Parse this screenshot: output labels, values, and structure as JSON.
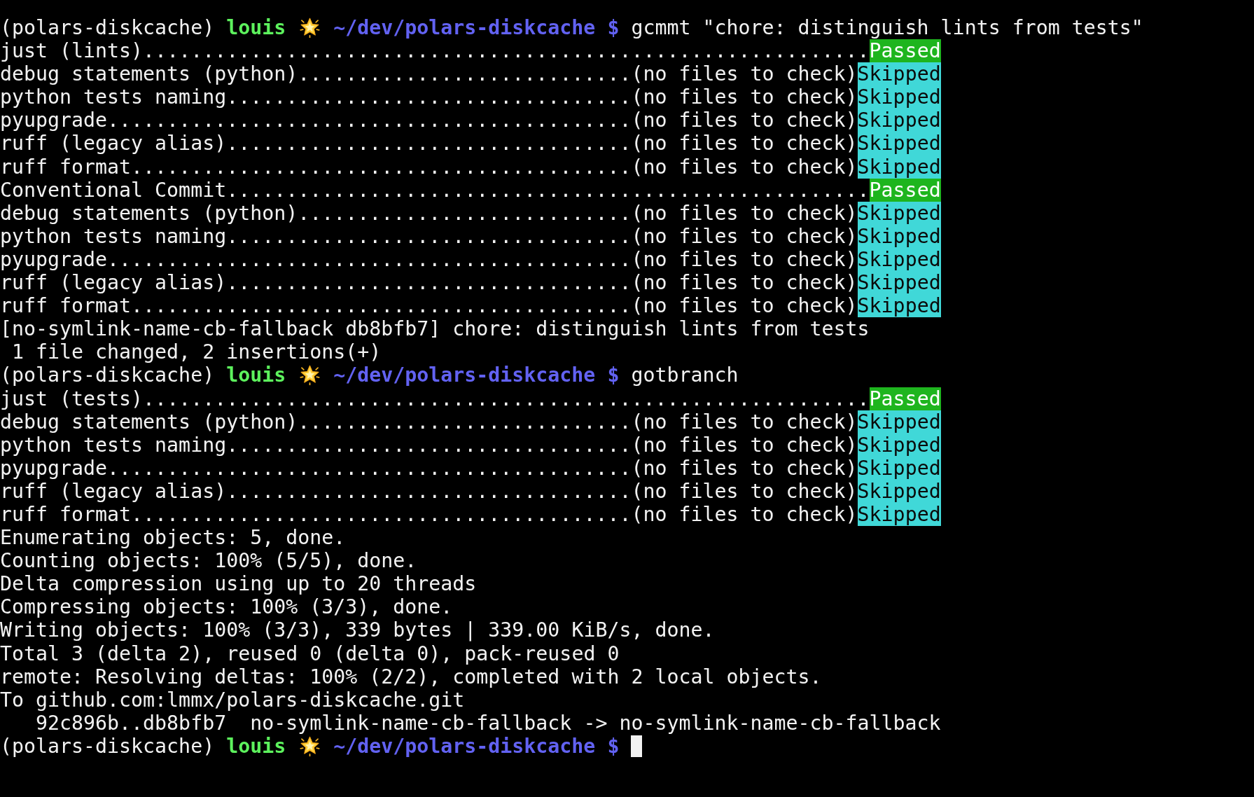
{
  "lines": [
    {
      "kind": "prompt",
      "env": "(polars-diskcache)",
      "user": "louis",
      "path": "~/dev/polars-diskcache",
      "symbol": "$",
      "command": "gcmmt \"chore: distinguish lints from tests\"",
      "cursor": false
    },
    {
      "kind": "hook",
      "name": "just (lints)",
      "leader": ".............................................................",
      "status": "Passed",
      "color": "#1eb51e"
    },
    {
      "kind": "hook",
      "name": "debug statements (python)",
      "leader": "............................",
      "note": "(no files to check)",
      "status": "Skipped",
      "color": "#40d8d8"
    },
    {
      "kind": "hook",
      "name": "python tests naming",
      "leader": "..................................",
      "note": "(no files to check)",
      "status": "Skipped",
      "color": "#40d8d8"
    },
    {
      "kind": "hook",
      "name": "pyupgrade",
      "leader": "............................................",
      "note": "(no files to check)",
      "status": "Skipped",
      "color": "#40d8d8"
    },
    {
      "kind": "hook",
      "name": "ruff (legacy alias)",
      "leader": "..................................",
      "note": "(no files to check)",
      "status": "Skipped",
      "color": "#40d8d8"
    },
    {
      "kind": "hook",
      "name": "ruff format",
      "leader": "..........................................",
      "note": "(no files to check)",
      "status": "Skipped",
      "color": "#40d8d8"
    },
    {
      "kind": "hook",
      "name": "Conventional Commit",
      "leader": "......................................................",
      "status": "Passed",
      "color": "#1eb51e"
    },
    {
      "kind": "hook",
      "name": "debug statements (python)",
      "leader": "............................",
      "note": "(no files to check)",
      "status": "Skipped",
      "color": "#40d8d8"
    },
    {
      "kind": "hook",
      "name": "python tests naming",
      "leader": "..................................",
      "note": "(no files to check)",
      "status": "Skipped",
      "color": "#40d8d8"
    },
    {
      "kind": "hook",
      "name": "pyupgrade",
      "leader": "............................................",
      "note": "(no files to check)",
      "status": "Skipped",
      "color": "#40d8d8"
    },
    {
      "kind": "hook",
      "name": "ruff (legacy alias)",
      "leader": "..................................",
      "note": "(no files to check)",
      "status": "Skipped",
      "color": "#40d8d8"
    },
    {
      "kind": "hook",
      "name": "ruff format",
      "leader": "..........................................",
      "note": "(no files to check)",
      "status": "Skipped",
      "color": "#40d8d8"
    },
    {
      "kind": "output",
      "text": "[no-symlink-name-cb-fallback db8bfb7] chore: distinguish lints from tests"
    },
    {
      "kind": "output",
      "text": " 1 file changed, 2 insertions(+)"
    },
    {
      "kind": "prompt",
      "env": "(polars-diskcache)",
      "user": "louis",
      "path": "~/dev/polars-diskcache",
      "symbol": "$",
      "command": "gotbranch",
      "cursor": false
    },
    {
      "kind": "hook",
      "name": "just (tests)",
      "leader": ".............................................................",
      "status": "Passed",
      "color": "#1eb51e"
    },
    {
      "kind": "hook",
      "name": "debug statements (python)",
      "leader": "............................",
      "note": "(no files to check)",
      "status": "Skipped",
      "color": "#40d8d8"
    },
    {
      "kind": "hook",
      "name": "python tests naming",
      "leader": "..................................",
      "note": "(no files to check)",
      "status": "Skipped",
      "color": "#40d8d8"
    },
    {
      "kind": "hook",
      "name": "pyupgrade",
      "leader": "............................................",
      "note": "(no files to check)",
      "status": "Skipped",
      "color": "#40d8d8"
    },
    {
      "kind": "hook",
      "name": "ruff (legacy alias)",
      "leader": "..................................",
      "note": "(no files to check)",
      "status": "Skipped",
      "color": "#40d8d8"
    },
    {
      "kind": "hook",
      "name": "ruff format",
      "leader": "..........................................",
      "note": "(no files to check)",
      "status": "Skipped",
      "color": "#40d8d8"
    },
    {
      "kind": "output",
      "text": "Enumerating objects: 5, done."
    },
    {
      "kind": "output",
      "text": "Counting objects: 100% (5/5), done."
    },
    {
      "kind": "output",
      "text": "Delta compression using up to 20 threads"
    },
    {
      "kind": "output",
      "text": "Compressing objects: 100% (3/3), done."
    },
    {
      "kind": "output",
      "text": "Writing objects: 100% (3/3), 339 bytes | 339.00 KiB/s, done."
    },
    {
      "kind": "output",
      "text": "Total 3 (delta 2), reused 0 (delta 0), pack-reused 0"
    },
    {
      "kind": "output",
      "text": "remote: Resolving deltas: 100% (2/2), completed with 2 local objects."
    },
    {
      "kind": "output",
      "text": "To github.com:lmmx/polars-diskcache.git"
    },
    {
      "kind": "output",
      "text": "   92c896b..db8bfb7  no-symlink-name-cb-fallback -> no-symlink-name-cb-fallback"
    },
    {
      "kind": "prompt",
      "env": "(polars-diskcache)",
      "user": "louis",
      "path": "~/dev/polars-diskcache",
      "symbol": "$",
      "cursor": true
    }
  ]
}
